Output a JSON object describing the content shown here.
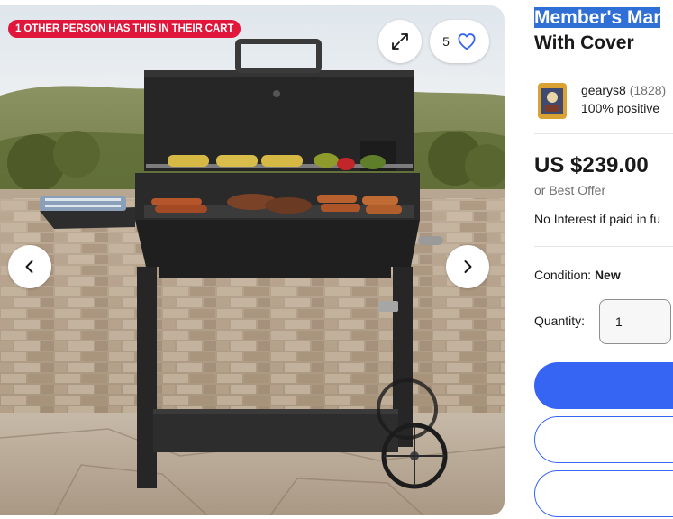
{
  "gallery": {
    "cart_badge": "1 OTHER PERSON HAS THIS IN THEIR CART",
    "watch_count": "5",
    "icons": {
      "expand": "expand-icon",
      "watch": "heart-icon",
      "prev": "chevron-left-icon",
      "next": "chevron-right-icon"
    }
  },
  "listing": {
    "title_line1": "Member's Mar",
    "title_line2": "With Cover",
    "seller": {
      "name": "gearys8",
      "score": "(1828)",
      "feedback": "100% positive"
    },
    "price": "US $239.00",
    "best_offer": "or Best Offer",
    "financing": "No Interest if paid in fu",
    "condition_label": "Condition:",
    "condition_value": "New",
    "quantity_label": "Quantity:",
    "quantity_value": "1"
  },
  "colors": {
    "badge": "#e0163b",
    "accent": "#3665f3",
    "highlight": "#2f6fd6"
  }
}
